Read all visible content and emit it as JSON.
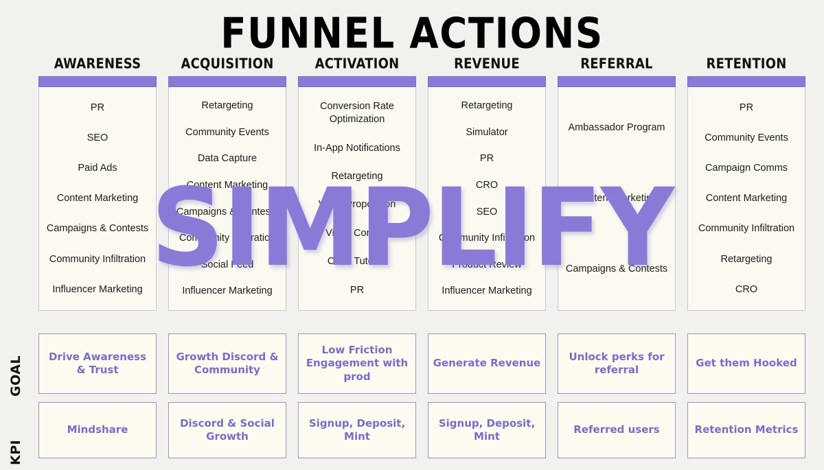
{
  "page": {
    "title": "FUNNEL ACTIONS",
    "watermark": "SIMPLIFY",
    "background_color": "#f2f1ee",
    "accent_color": "#8a7ad8",
    "card_color": "#fbf9f0",
    "goal_kpi_text_color": "#7a6cc8"
  },
  "row_labels": {
    "goal": "GOAL",
    "kpi": "KPI"
  },
  "columns": [
    {
      "header": "AWARENESS",
      "actions": [
        "PR",
        "SEO",
        "Paid Ads",
        "Content Marketing",
        "Campaigns & Contests",
        "Community Infiltration",
        "Influencer Marketing"
      ],
      "goal": "Drive Awareness & Trust",
      "kpi": "Mindshare"
    },
    {
      "header": "ACQUISITION",
      "actions": [
        "Retargeting",
        "Community Events",
        "Data Capture",
        "Content Marketing",
        "Campaigns & Contests",
        "Community Infiltration",
        "Social Feed",
        "Influencer Marketing"
      ],
      "goal": "Growth Discord & Community",
      "kpi": "Discord & Social Growth"
    },
    {
      "header": "ACTIVATION",
      "actions": [
        "Conversion Rate Optimization",
        "In-App Notifications",
        "Retargeting",
        "Value Proposition",
        "Video Content",
        "Clear Tutorial",
        "PR"
      ],
      "goal": "Low Friction Engagement with prod",
      "kpi": "Signup, Deposit, Mint"
    },
    {
      "header": "REVENUE",
      "actions": [
        "Retargeting",
        "Simulator",
        "PR",
        "CRO",
        "SEO",
        "Community Infiltration",
        "Product Review",
        "Influencer Marketing"
      ],
      "goal": "Generate Revenue",
      "kpi": "Signup, Deposit, Mint"
    },
    {
      "header": "REFERRAL",
      "actions": [
        "Ambassador Program",
        "Content Marketing",
        "Campaigns & Contests"
      ],
      "goal": "Unlock perks for referral",
      "kpi": "Referred users"
    },
    {
      "header": "RETENTION",
      "actions": [
        "PR",
        "Community Events",
        "Campaign Comms",
        "Content Marketing",
        "Community Infiltration",
        "Retargeting",
        "CRO"
      ],
      "goal": "Get them Hooked",
      "kpi": "Retention Metrics"
    }
  ]
}
